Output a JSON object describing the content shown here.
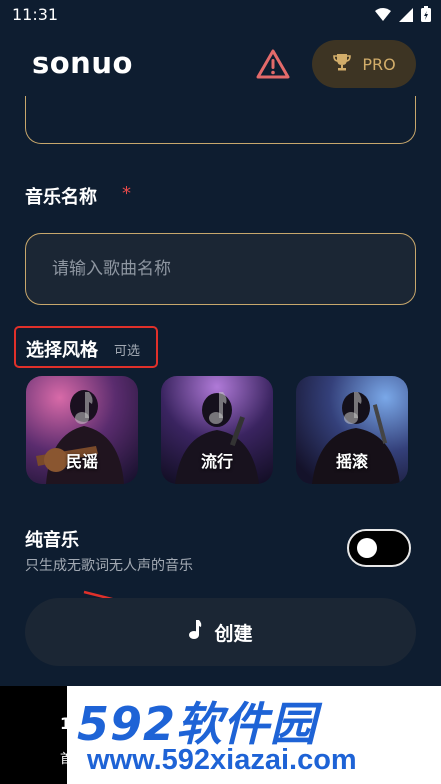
{
  "status_bar": {
    "time": "11:31"
  },
  "header": {
    "title": "sonuo",
    "pro_label": "PRO"
  },
  "music_name": {
    "label": "音乐名称",
    "required_mark": "*",
    "placeholder": "请输入歌曲名称"
  },
  "style_section": {
    "title": "选择风格",
    "optional": "可选",
    "styles": [
      {
        "label": "民谣",
        "tint": "#6a3a7a"
      },
      {
        "label": "流行",
        "tint": "#3a2a6a"
      },
      {
        "label": "摇滚",
        "tint": "#2a4a7a"
      }
    ]
  },
  "pure_music": {
    "title": "纯音乐",
    "description": "只生成无歌词无人声的音乐",
    "enabled": false
  },
  "create_button": {
    "label": "创建"
  },
  "bottom_nav": {
    "item_icon": "1",
    "item_label": "首"
  },
  "watermark": {
    "brand": "592软件园",
    "url": "www.592xiazai.com"
  },
  "colors": {
    "background": "#0e1d30",
    "accent_gold": "#c7a76c",
    "required_red": "#e84a4a",
    "highlight_box": "#e0302a",
    "watermark_blue": "#1e63d6"
  }
}
